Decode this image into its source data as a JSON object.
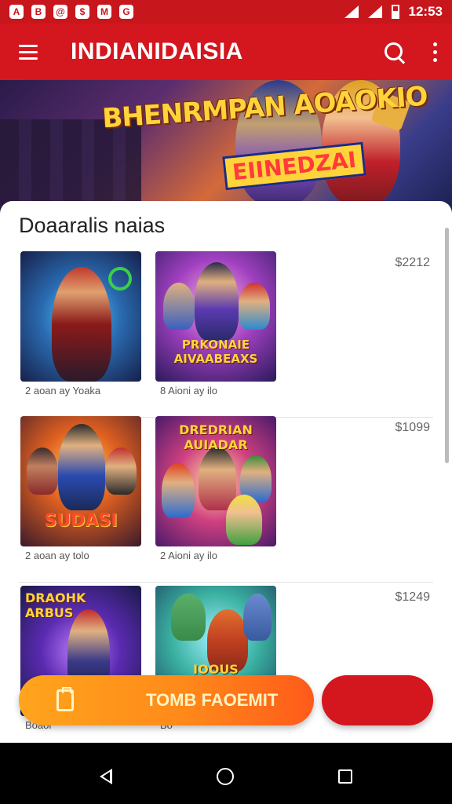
{
  "status_bar": {
    "left_icons": [
      "A",
      "B",
      "@",
      "$",
      "M",
      "G"
    ],
    "time": "12:53"
  },
  "app_bar": {
    "title": "INDIANIDAISIA"
  },
  "banner": {
    "headline": "BHENRMPAN AOAOKIO",
    "badge": "EIINEDZAI"
  },
  "section": {
    "title": "Doaaralis naias"
  },
  "rows": [
    {
      "price": "$2212",
      "games": [
        {
          "art": "",
          "label": "2 aoan ay Yoaka"
        },
        {
          "art": "PRKONAIE AIVAABEAXS",
          "label": "8 Aioni ay ilo"
        }
      ]
    },
    {
      "price": "$1099",
      "games": [
        {
          "art": "SUDASI",
          "label": "2 aoan ay tolo"
        },
        {
          "art": "DREDRIAN AUIADAR",
          "label": "2 Aioni ay ilo"
        }
      ]
    },
    {
      "price": "$1249",
      "games": [
        {
          "art": "DRAOHK ARBUS",
          "label": "Boaor"
        },
        {
          "art": "IOOUS",
          "label": "Bo"
        }
      ]
    }
  ],
  "actions": {
    "primary_label": "TOMB FAOEMIT"
  },
  "colors": {
    "app_bar": "#d4161f",
    "cta_start": "#ffa41c",
    "cta_end": "#ff5a1a"
  }
}
